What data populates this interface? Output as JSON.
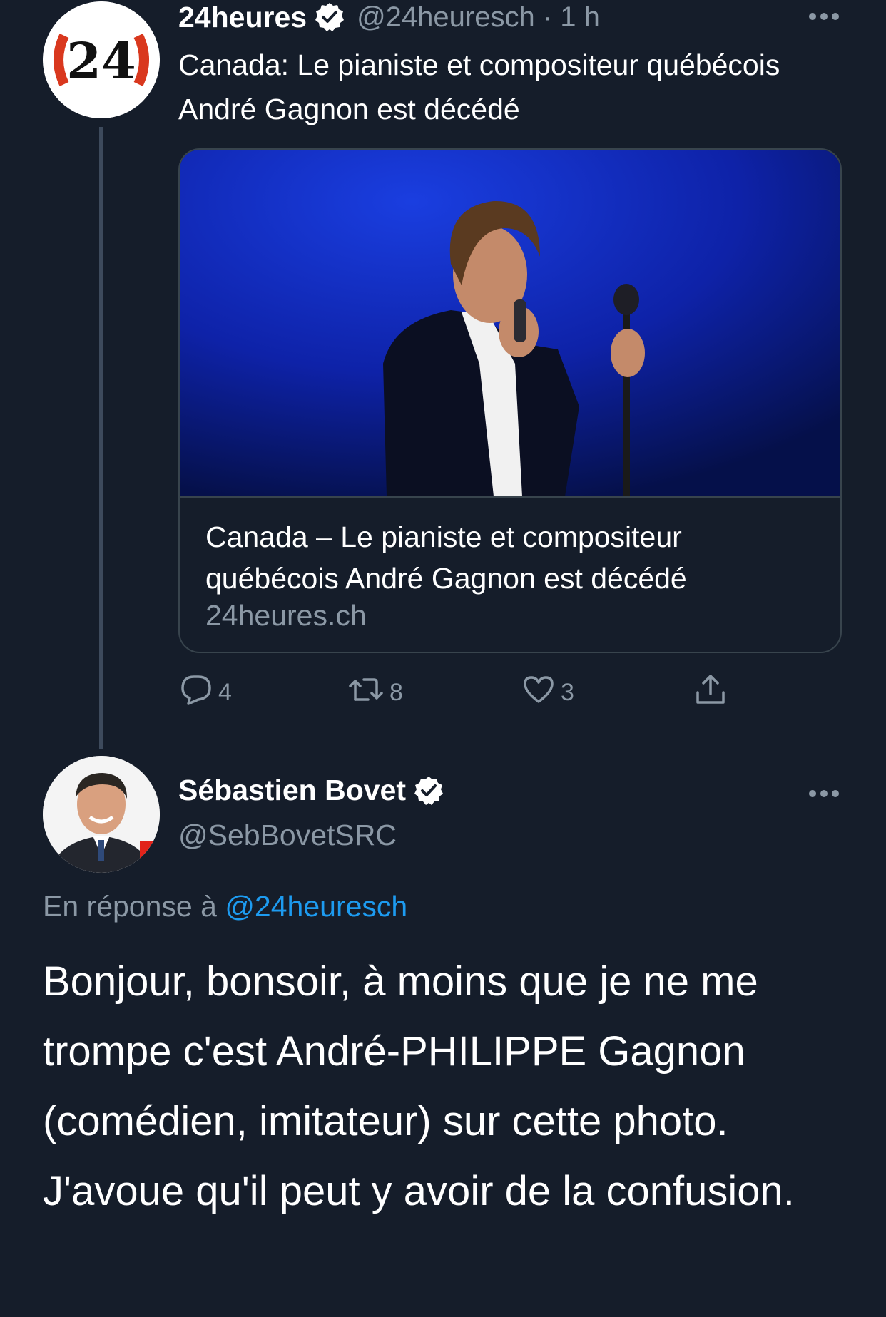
{
  "tweet1": {
    "author_name": "24heures",
    "handle": "@24heuresch",
    "separator": "·",
    "time": "1 h",
    "avatar_text": "24",
    "text": "Canada: Le pianiste et compositeur québécois André Gagnon est décédé",
    "card": {
      "title": "Canada – Le pianiste et compositeur québécois André Gagnon est décédé",
      "domain": "24heures.ch"
    },
    "actions": {
      "replies": "4",
      "retweets": "8",
      "likes": "3"
    }
  },
  "tweet2": {
    "author_name": "Sébastien Bovet",
    "handle": "@SebBovetSRC",
    "reply_prefix": "En réponse à",
    "reply_mention": "@24heuresch",
    "paragraph1": "Bonjour, bonsoir, à moins que je ne me trompe c'est André-PHILIPPE Gagnon (comédien, imitateur) sur cette photo.",
    "paragraph2": "J'avoue qu'il peut y avoir de la confusion."
  },
  "icons": {
    "verified": "verified-badge-icon",
    "more": "more-dots-icon",
    "reply": "reply-icon",
    "retweet": "retweet-icon",
    "like": "heart-icon",
    "share": "share-icon"
  },
  "colors": {
    "background": "#151d2a",
    "secondary_text": "#8b98a5",
    "link": "#1d9bf0",
    "brand_24_red": "#d9381e"
  }
}
